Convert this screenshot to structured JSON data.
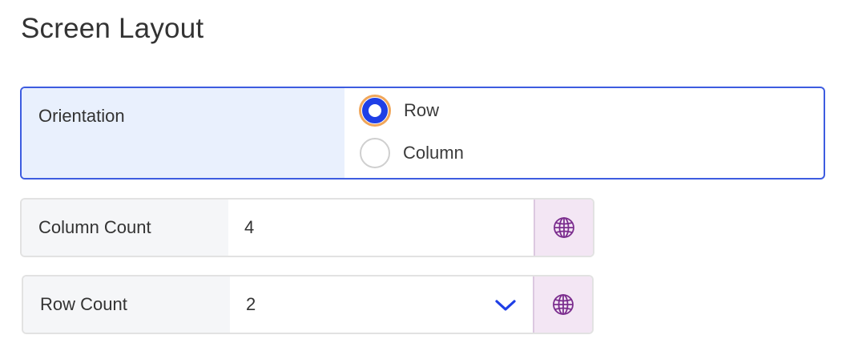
{
  "page": {
    "title": "Screen Layout"
  },
  "orientation": {
    "label": "Orientation",
    "options": [
      {
        "label": "Row",
        "selected": true
      },
      {
        "label": "Column",
        "selected": false
      }
    ]
  },
  "column_count": {
    "label": "Column Count",
    "value": "4",
    "action_icon": "globe-icon"
  },
  "row_count": {
    "label": "Row Count",
    "value": "2",
    "dropdown_icon": "chevron-down-icon",
    "action_icon": "globe-icon"
  },
  "colors": {
    "focus_border": "#3d5ce0",
    "radio_selected": "#1f3fe6",
    "radio_focus_ring": "#f0a65a",
    "label_bg_focused": "#e9f0fd",
    "label_bg": "#f5f6f8",
    "icon_button_bg": "#f3e6f4",
    "icon_color": "#7b2d8e",
    "chevron_color": "#1f3fe6"
  }
}
